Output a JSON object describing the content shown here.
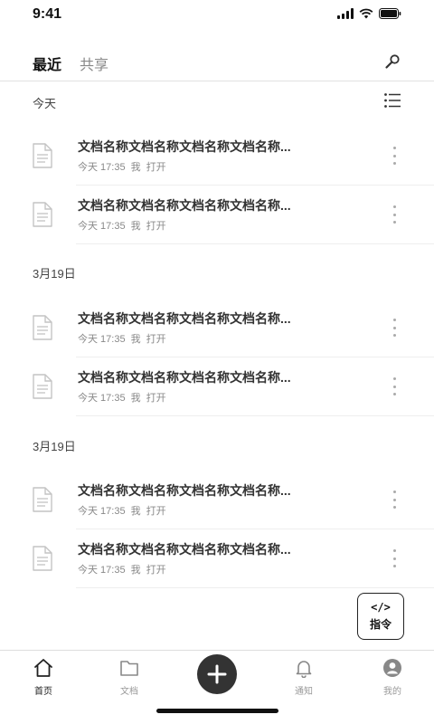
{
  "status": {
    "time": "9:41"
  },
  "header": {
    "tabs": [
      {
        "label": "最近"
      },
      {
        "label": "共享"
      }
    ]
  },
  "sections": [
    {
      "title": "今天",
      "docs": [
        {
          "title": "文档名称文档名称文档名称文档名称...",
          "date": "今天 17:35",
          "user": "我",
          "action": "打开"
        },
        {
          "title": "文档名称文档名称文档名称文档名称...",
          "date": "今天 17:35",
          "user": "我",
          "action": "打开"
        }
      ]
    },
    {
      "title": "3月19日",
      "docs": [
        {
          "title": "文档名称文档名称文档名称文档名称...",
          "date": "今天 17:35",
          "user": "我",
          "action": "打开"
        },
        {
          "title": "文档名称文档名称文档名称文档名称...",
          "date": "今天 17:35",
          "user": "我",
          "action": "打开"
        }
      ]
    },
    {
      "title": "3月19日",
      "docs": [
        {
          "title": "文档名称文档名称文档名称文档名称...",
          "date": "今天 17:35",
          "user": "我",
          "action": "打开"
        },
        {
          "title": "文档名称文档名称文档名称文档名称...",
          "date": "今天 17:35",
          "user": "我",
          "action": "打开"
        }
      ]
    }
  ],
  "command": {
    "icon_text": "</>",
    "label": "指令"
  },
  "nav": {
    "items": [
      {
        "label": "首页",
        "icon": "home-icon"
      },
      {
        "label": "文档",
        "icon": "folder-icon"
      },
      {
        "label": "",
        "icon": "plus-icon"
      },
      {
        "label": "通知",
        "icon": "bell-icon"
      },
      {
        "label": "我的",
        "icon": "user-icon"
      }
    ]
  },
  "colors": {
    "text": "#333333",
    "muted": "#888888",
    "add_button": "#333333"
  }
}
